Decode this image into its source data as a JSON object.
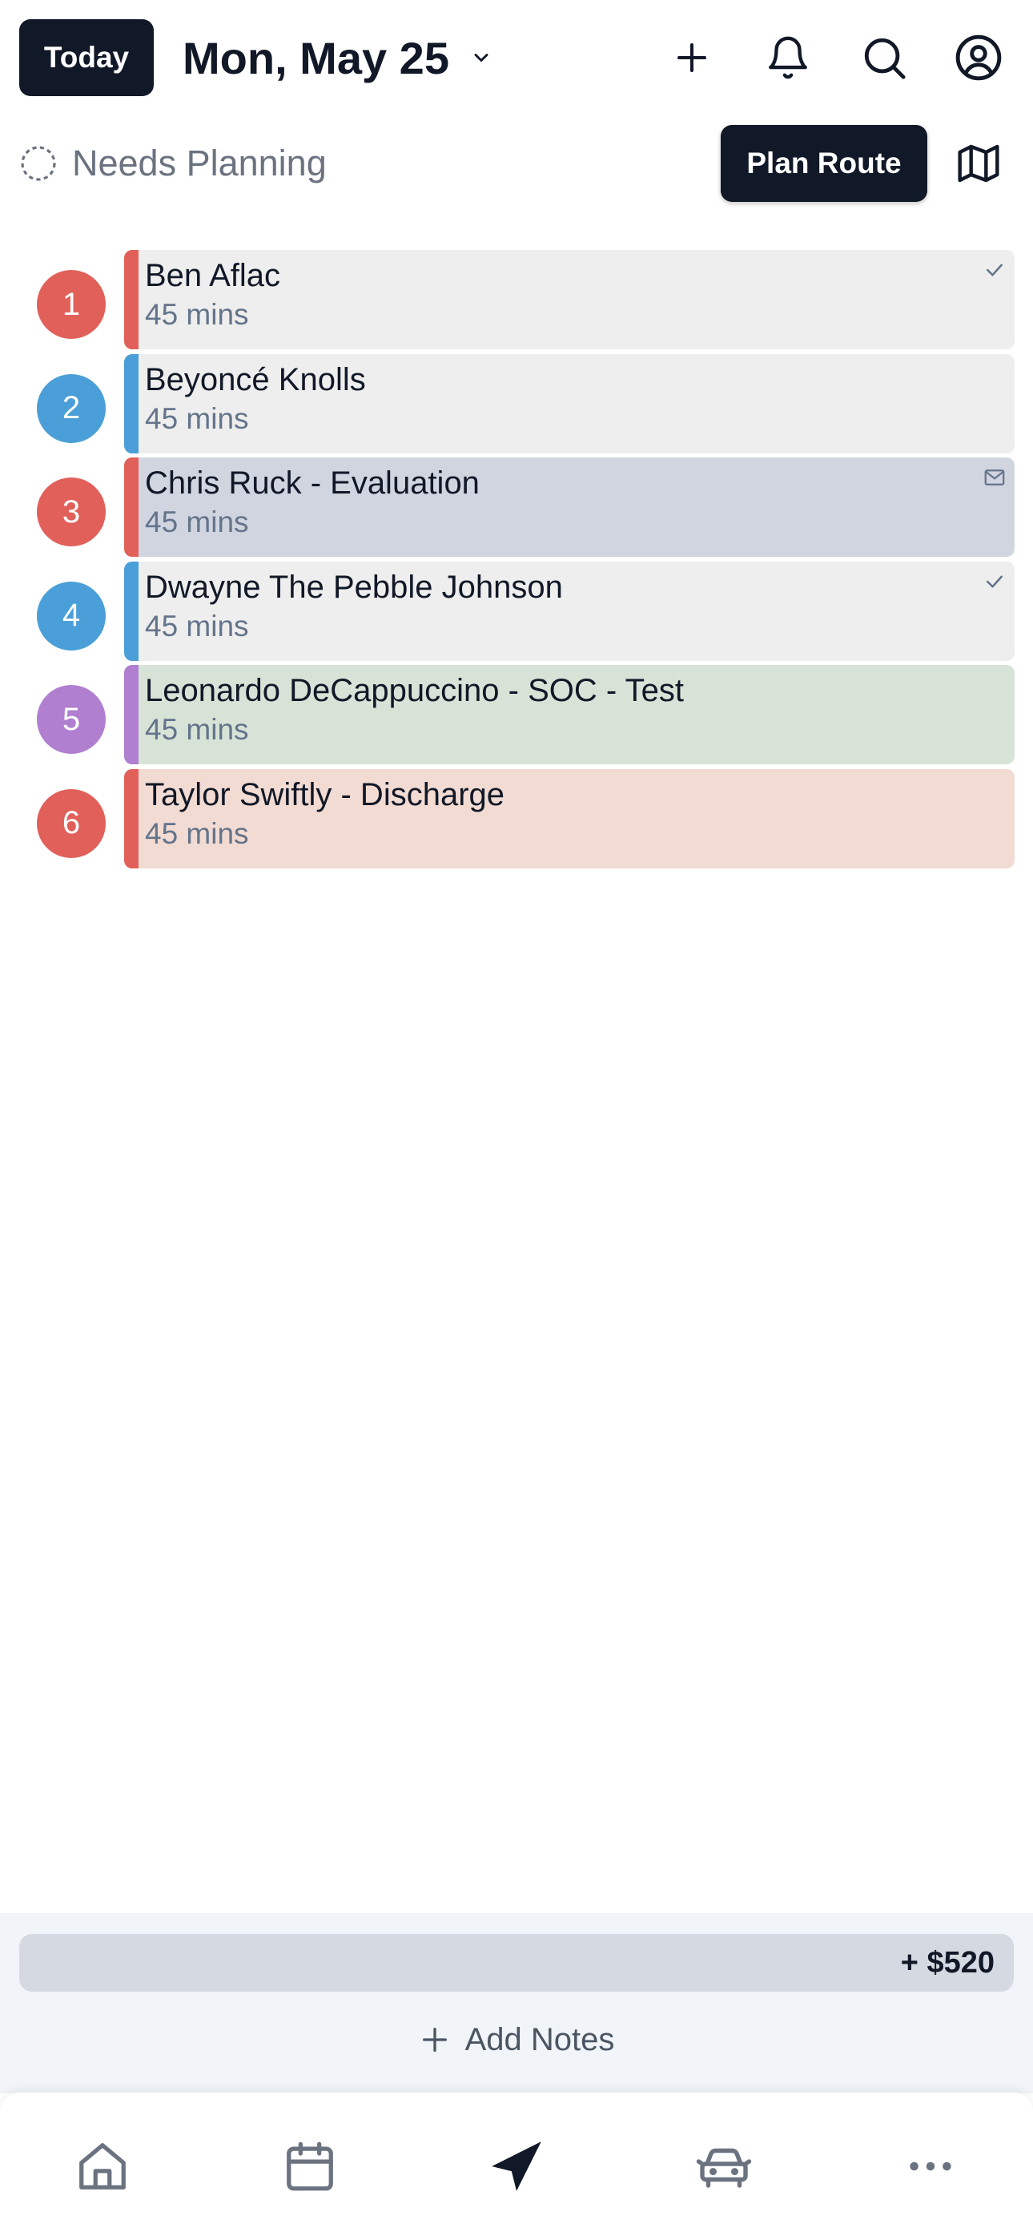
{
  "header": {
    "today_label": "Today",
    "date_title": "Mon, May 25",
    "icons": [
      "chevron-down-icon",
      "plus-icon",
      "bell-icon",
      "search-icon",
      "user-circle-icon"
    ]
  },
  "planning": {
    "needs_planning_label": "Needs Planning",
    "plan_route_label": "Plan Route",
    "map_icon": "map-icon"
  },
  "visits": [
    {
      "number": "1",
      "name": "Ben Aflac",
      "duration": "45 mins",
      "badge_color": "#e2605a",
      "bar_color": "#e2605a",
      "card_color": "#eeeeee",
      "marker": "check-icon"
    },
    {
      "number": "2",
      "name": "Beyoncé Knolls",
      "duration": "45 mins",
      "badge_color": "#4a9fd8",
      "bar_color": "#4a9fd8",
      "card_color": "#eeeeee",
      "marker": ""
    },
    {
      "number": "3",
      "name": "Chris Ruck - Evaluation",
      "duration": "45 mins",
      "badge_color": "#e2605a",
      "bar_color": "#e2605a",
      "card_color": "#d0d5e0",
      "marker": "mail-icon"
    },
    {
      "number": "4",
      "name": "Dwayne The Pebble Johnson",
      "duration": "45 mins",
      "badge_color": "#4a9fd8",
      "bar_color": "#4a9fd8",
      "card_color": "#eeeeee",
      "marker": "check-icon"
    },
    {
      "number": "5",
      "name": "Leonardo DeCappuccino - SOC - Test",
      "duration": "45 mins",
      "badge_color": "#b07fd0",
      "bar_color": "#b07fd0",
      "card_color": "#d8e3d8",
      "marker": ""
    },
    {
      "number": "6",
      "name": "Taylor Swiftly - Discharge",
      "duration": "45 mins",
      "badge_color": "#e2605a",
      "bar_color": "#e2605a",
      "card_color": "#f2dbd3",
      "marker": ""
    }
  ],
  "summary": {
    "amount": "+ $520",
    "add_notes_label": "Add Notes"
  },
  "bottom_nav": {
    "items": [
      "home-icon",
      "calendar-icon",
      "navigation-icon",
      "car-icon",
      "more-icon"
    ],
    "active": "navigation-icon"
  }
}
